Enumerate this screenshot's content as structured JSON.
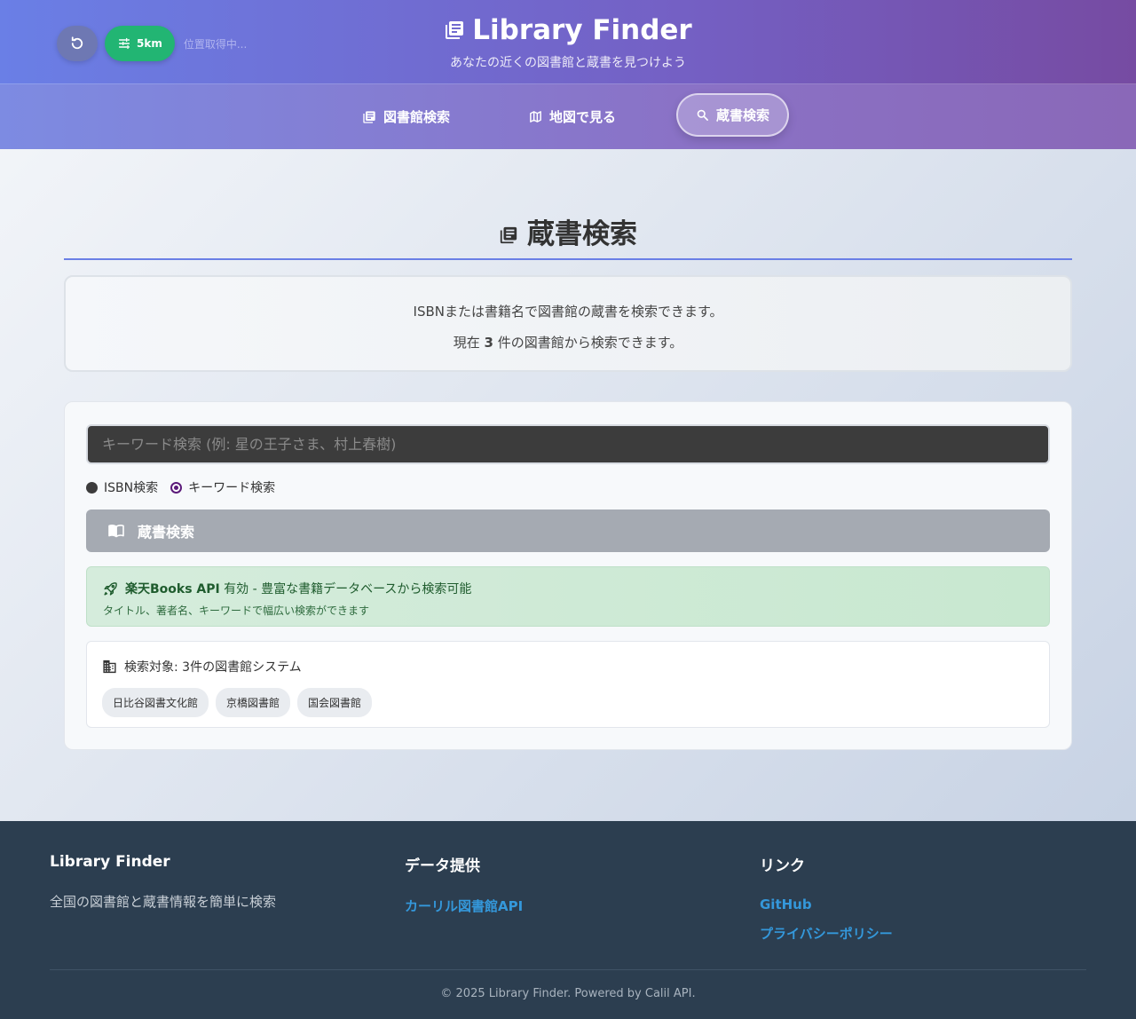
{
  "header": {
    "title": "Library Finder",
    "subtitle": "あなたの近くの図書館と蔵書を見つけよう",
    "radius_label": "5km",
    "location_status": "位置取得中..."
  },
  "nav": {
    "items": [
      {
        "label": "図書館検索",
        "icon": "library-icon",
        "active": false
      },
      {
        "label": "地図で見る",
        "icon": "map-icon",
        "active": false
      },
      {
        "label": "蔵書検索",
        "icon": "search-icon",
        "active": true
      }
    ]
  },
  "main": {
    "section_title": "蔵書検索",
    "info_line1": "ISBNまたは書籍名で図書館の蔵書を検索できます。",
    "info_line2_prefix": "現在 ",
    "info_count": "3",
    "info_line2_suffix": " 件の図書館から検索できます。",
    "search": {
      "placeholder": "キーワード検索 (例: 星の王子さま、村上春樹)",
      "value": ""
    },
    "radio_options": [
      {
        "label": "ISBN検索",
        "selected": false
      },
      {
        "label": "キーワード検索",
        "selected": true
      }
    ],
    "submit_label": "蔵書検索",
    "api_notice": {
      "name": "楽天Books API",
      "text": " 有効 - 豊富な書籍データベースから検索可能",
      "sub": "タイトル、著者名、キーワードで幅広い検索ができます"
    },
    "targets": {
      "label": "検索対象: 3件の図書館システム",
      "libraries": [
        "日比谷図書文化館",
        "京橋図書館",
        "国会図書館"
      ]
    }
  },
  "footer": {
    "col1_title": "Library Finder",
    "col1_text": "全国の図書館と蔵書情報を簡単に検索",
    "col2_title": "データ提供",
    "col2_link": "カーリル図書館API",
    "col3_title": "リンク",
    "col3_links": [
      "GitHub",
      "プライバシーポリシー"
    ],
    "copyright": "© 2025 Library Finder. Powered by Calil API."
  },
  "colors": {
    "accent": "#6a7fe6",
    "brand_purple": "#764ba2",
    "radius_green": "#22b573",
    "footer_bg": "#2c3e50",
    "link_blue": "#3498db"
  }
}
